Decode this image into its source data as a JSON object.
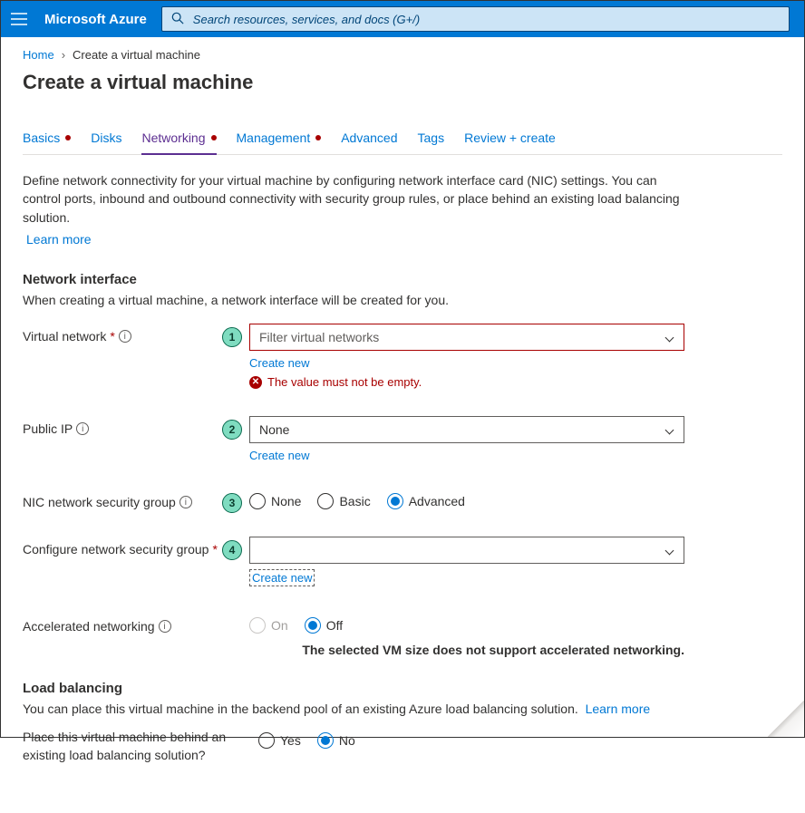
{
  "header": {
    "brand": "Microsoft Azure",
    "search_placeholder": "Search resources, services, and docs (G+/)"
  },
  "breadcrumb": {
    "home": "Home",
    "current": "Create a virtual machine"
  },
  "page_title": "Create a virtual machine",
  "tabs": {
    "basics": "Basics",
    "disks": "Disks",
    "networking": "Networking",
    "management": "Management",
    "advanced": "Advanced",
    "tags": "Tags",
    "review": "Review + create"
  },
  "intro": {
    "text": "Define network connectivity for your virtual machine by configuring network interface card (NIC) settings. You can control ports, inbound and outbound connectivity with security group rules, or place behind an existing load balancing solution.",
    "learn_more": "Learn more"
  },
  "network_interface": {
    "heading": "Network interface",
    "sub": "When creating a virtual machine, a network interface will be created for you."
  },
  "callouts": {
    "c1": "1",
    "c2": "2",
    "c3": "3",
    "c4": "4"
  },
  "fields": {
    "virtual_network": {
      "label": "Virtual network",
      "placeholder": "Filter virtual networks",
      "create_new": "Create new",
      "error": "The value must not be empty."
    },
    "public_ip": {
      "label": "Public IP",
      "value": "None",
      "create_new": "Create new"
    },
    "nsg": {
      "label": "NIC network security group",
      "options": {
        "none": "None",
        "basic": "Basic",
        "advanced": "Advanced"
      }
    },
    "configure_nsg": {
      "label": "Configure network security group",
      "value": "",
      "create_new": "Create new"
    },
    "accel_net": {
      "label": "Accelerated networking",
      "options": {
        "on": "On",
        "off": "Off"
      },
      "note": "The selected VM size does not support accelerated networking."
    }
  },
  "load_balancing": {
    "heading": "Load balancing",
    "intro": "You can place this virtual machine in the backend pool of an existing Azure load balancing solution.",
    "learn_more": "Learn more",
    "question": "Place this virtual machine behind an existing load balancing solution?",
    "options": {
      "yes": "Yes",
      "no": "No"
    }
  }
}
